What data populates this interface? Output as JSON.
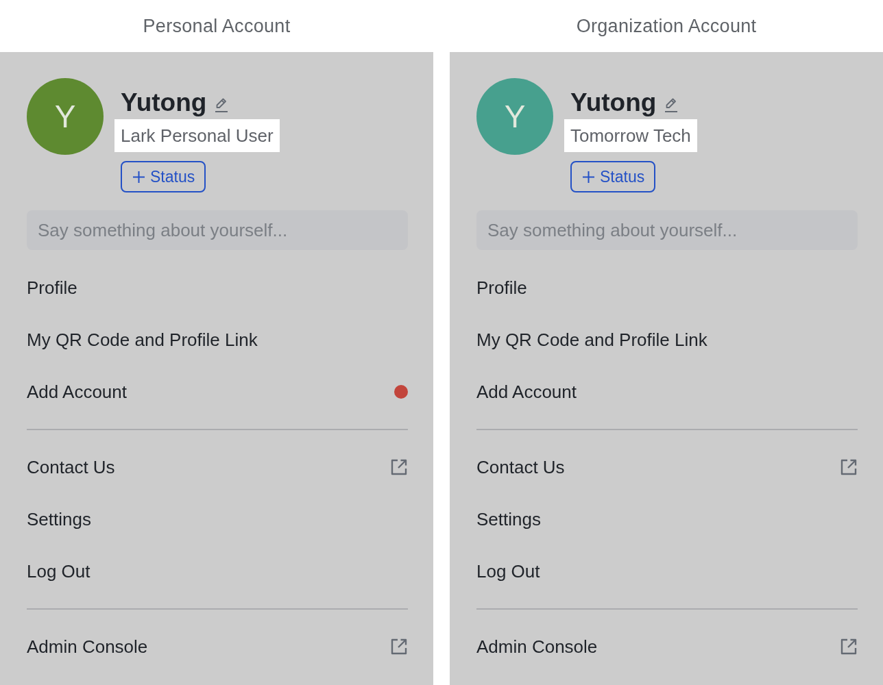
{
  "panels": [
    {
      "caption": "Personal Account",
      "avatar": {
        "initial": "Y",
        "color": "#5e8a30"
      },
      "name": "Yutong",
      "subtitle": "Lark Personal User",
      "status_button": "Status",
      "bio": {
        "placeholder": "Say something about yourself..."
      },
      "menu_groups": [
        [
          {
            "label": "Profile",
            "kind": "plain"
          },
          {
            "label": "My QR Code and Profile Link",
            "kind": "plain"
          },
          {
            "label": "Add Account",
            "kind": "notice"
          }
        ],
        [
          {
            "label": "Contact Us",
            "kind": "external"
          },
          {
            "label": "Settings",
            "kind": "plain"
          },
          {
            "label": "Log Out",
            "kind": "plain"
          }
        ],
        [
          {
            "label": "Admin Console",
            "kind": "external"
          }
        ]
      ]
    },
    {
      "caption": "Organization Account",
      "avatar": {
        "initial": "Y",
        "color": "#47a08e"
      },
      "name": "Yutong",
      "subtitle": "Tomorrow Tech",
      "status_button": "Status",
      "bio": {
        "placeholder": "Say something about yourself..."
      },
      "menu_groups": [
        [
          {
            "label": "Profile",
            "kind": "plain"
          },
          {
            "label": "My QR Code and Profile Link",
            "kind": "plain"
          },
          {
            "label": "Add Account",
            "kind": "plain"
          }
        ],
        [
          {
            "label": "Contact Us",
            "kind": "external"
          },
          {
            "label": "Settings",
            "kind": "plain"
          },
          {
            "label": "Log Out",
            "kind": "plain"
          }
        ],
        [
          {
            "label": "Admin Console",
            "kind": "external"
          }
        ]
      ]
    }
  ]
}
